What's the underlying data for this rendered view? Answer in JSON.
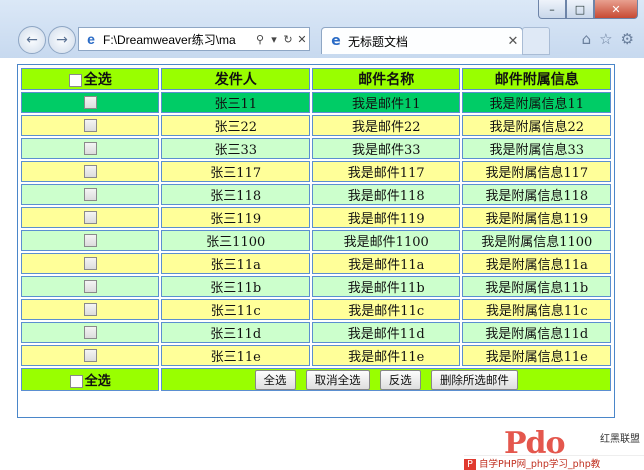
{
  "browser": {
    "address": "F:\\Dreamweaver练习\\ma",
    "tab_title": "无标题文档"
  },
  "table": {
    "headers": {
      "select_all": "全选",
      "sender": "发件人",
      "mail_name": "邮件名称",
      "mail_attach": "邮件附属信息"
    },
    "rows": [
      {
        "sender": "张三11",
        "name": "我是邮件11",
        "info": "我是附属信息11"
      },
      {
        "sender": "张三22",
        "name": "我是邮件22",
        "info": "我是附属信息22"
      },
      {
        "sender": "张三33",
        "name": "我是邮件33",
        "info": "我是附属信息33"
      },
      {
        "sender": "张三117",
        "name": "我是邮件117",
        "info": "我是附属信息117"
      },
      {
        "sender": "张三118",
        "name": "我是邮件118",
        "info": "我是附属信息118"
      },
      {
        "sender": "张三119",
        "name": "我是邮件119",
        "info": "我是附属信息119"
      },
      {
        "sender": "张三1100",
        "name": "我是邮件1100",
        "info": "我是附属信息1100"
      },
      {
        "sender": "张三11a",
        "name": "我是邮件11a",
        "info": "我是附属信息11a"
      },
      {
        "sender": "张三11b",
        "name": "我是邮件11b",
        "info": "我是附属信息11b"
      },
      {
        "sender": "张三11c",
        "name": "我是邮件11c",
        "info": "我是附属信息11c"
      },
      {
        "sender": "张三11d",
        "name": "我是邮件11d",
        "info": "我是附属信息11d"
      },
      {
        "sender": "张三11e",
        "name": "我是邮件11e",
        "info": "我是附属信息11e"
      }
    ],
    "footer": {
      "select_all": "全选",
      "btn_select_all": "全选",
      "btn_cancel_all": "取消全选",
      "btn_invert": "反选",
      "btn_delete": "删除所选邮件"
    }
  },
  "watermark": {
    "logo": "Pdo",
    "brand": "红黑联盟",
    "bar": "自学PHP网_php学习_php教"
  },
  "colors": {
    "header_bg": "#99ff00",
    "row_yellow": "#ffff99",
    "row_green": "#ccffcc",
    "row_highlight": "#00cc66",
    "border": "#5b8fd0"
  }
}
